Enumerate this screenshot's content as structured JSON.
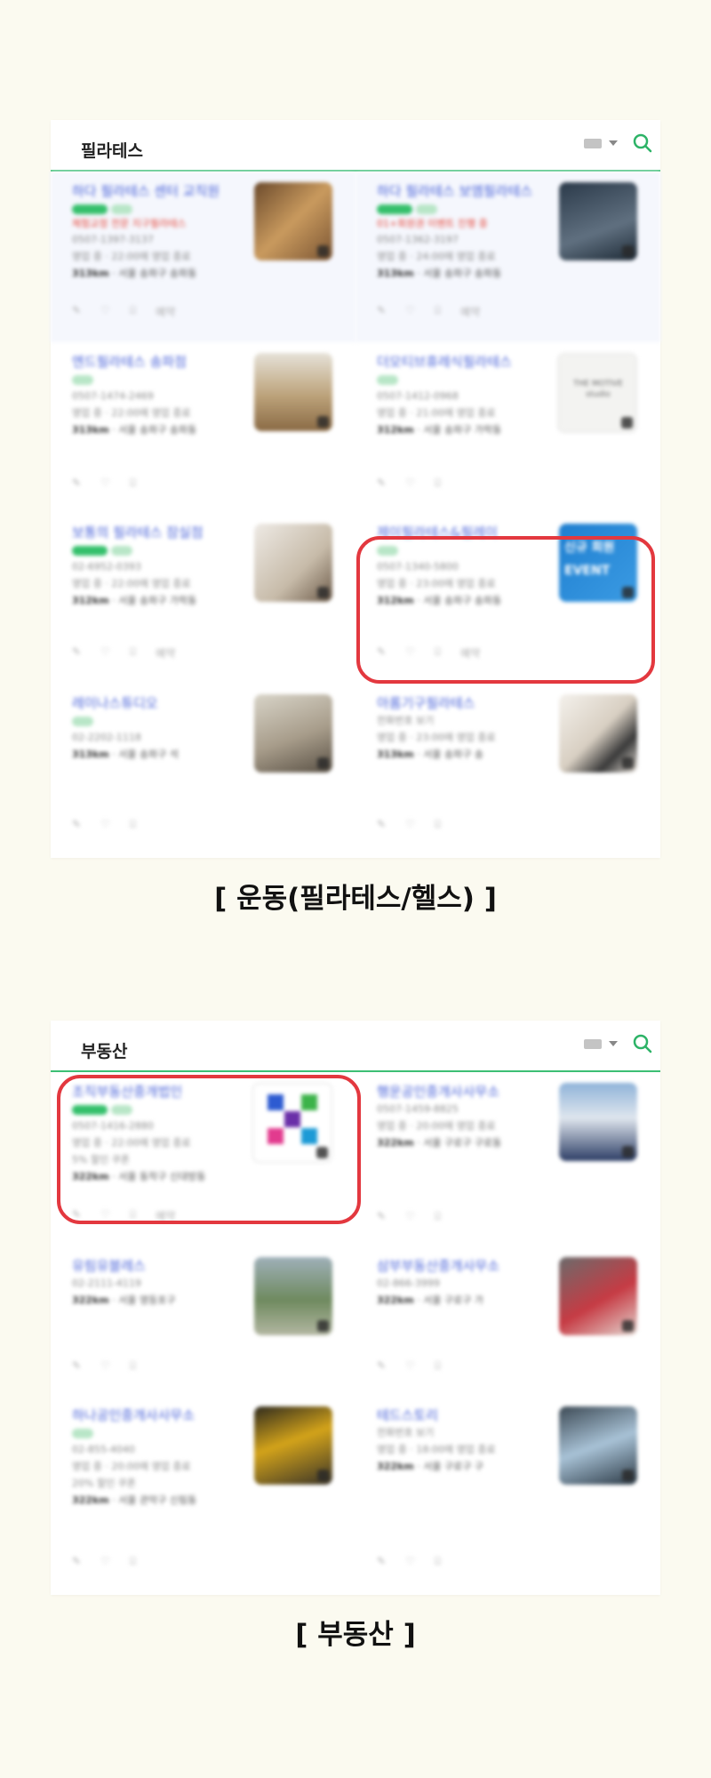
{
  "section1": {
    "title": "필라테스",
    "caption": "[ 운동(필라테스/헬스) ]",
    "cards": [
      {
        "name": "하다 필라테스 센터 교직원",
        "promo": "체험교정 전문 지구필라테스",
        "phone": "0507-1397-3137",
        "hours": "영업 중 · 22:00에 영업 종료",
        "dist": "313km",
        "addr": "· 서울 송파구 송파동",
        "actions": [
          "✎",
          "♡",
          "⌸",
          "예약"
        ]
      },
      {
        "name": "하다 필라테스 보엠필라테스",
        "promo": "01+회원권 이벤트 진행 중",
        "phone": "0507-1362-3197",
        "hours": "영업 중 · 24:00에 영업 종료",
        "dist": "313km",
        "addr": "· 서울 송파구 송파동",
        "actions": [
          "✎",
          "♡",
          "⌸",
          "예약"
        ]
      },
      {
        "name": "엔드필라테스 송파점",
        "promo": "",
        "phone": "0507-1474-2469",
        "hours": "영업 중 · 22:00에 영업 종료",
        "dist": "313km",
        "addr": "· 서울 송파구 송파동",
        "actions": [
          "✎",
          "♡",
          "⌸"
        ]
      },
      {
        "name": "더모티브휴레식필라테스",
        "promo": "",
        "phone": "0507-1412-0968",
        "hours": "영업 중 · 21:00에 영업 종료",
        "dist": "312km",
        "addr": "· 서울 송파구 가락동",
        "actions": [
          "✎",
          "♡",
          "⌸"
        ]
      },
      {
        "name": "보통의 필라테스 잠실점",
        "promo": "",
        "phone": "02-6952-0393",
        "hours": "영업 중 · 22:00에 영업 종료",
        "dist": "312km",
        "addr": "· 서울 송파구 가락동",
        "actions": [
          "✎",
          "♡",
          "⌸",
          "예약"
        ]
      },
      {
        "name": "제이필라테스&필레이",
        "promo": "",
        "phone": "0507-1340-5800",
        "hours": "영업 중 · 23:00에 영업 종료",
        "dist": "312km",
        "addr": "· 서울 송파구 송파동",
        "actions": [
          "✎",
          "♡",
          "⌸",
          "예약"
        ]
      },
      {
        "name": "레이나스튜디오",
        "promo": "",
        "phone": "02-2202-1118",
        "hours": "",
        "dist": "313km",
        "addr": "· 서울 송파구 석",
        "actions": [
          "✎",
          "♡",
          "⌸"
        ]
      },
      {
        "name": "아롬기구필라테스",
        "promo": "",
        "phone": "전화번호 보기",
        "hours": "영업 중 · 23:00에 영업 종료",
        "dist": "313km",
        "addr": "· 서울 송파구 송",
        "actions": [
          "✎",
          "♡",
          "⌸"
        ]
      }
    ],
    "event_lines": [
      "신규 회원",
      "EVENT"
    ],
    "motive_text": "THE MOTIVE studio"
  },
  "section2": {
    "title": "부동산",
    "caption": "[ 부동산 ]",
    "cards": [
      {
        "name": "조직부동산중개법인",
        "promo": "",
        "phone": "0507-1416-2880",
        "hours": "영업 중 · 22:00에 영업 종료",
        "extra": "5% 할인 쿠폰",
        "dist": "322km",
        "addr": "· 서울 동작구 신대방동",
        "actions": [
          "✎",
          "♡",
          "⌸",
          "예약"
        ]
      },
      {
        "name": "행운공인중개사사무소",
        "promo": "",
        "phone": "0507-1459-8825",
        "hours": "영업 중 · 20:00에 영업 종료",
        "extra": "",
        "dist": "322km",
        "addr": "· 서울 구로구 구로동",
        "actions": [
          "✎",
          "♡",
          "⌸"
        ]
      },
      {
        "name": "유림유블레스",
        "promo": "",
        "phone": "02-2111-4119",
        "hours": "",
        "extra": "",
        "dist": "322km",
        "addr": "· 서울 영등포구",
        "actions": [
          "✎",
          "♡",
          "⌸"
        ]
      },
      {
        "name": "삼부부동산중개사무소",
        "promo": "",
        "phone": "02-866-3999",
        "hours": "",
        "extra": "",
        "dist": "322km",
        "addr": "· 서울 구로구 가",
        "actions": [
          "✎",
          "♡",
          "⌸"
        ]
      },
      {
        "name": "하나공인중개사사무소",
        "promo": "",
        "phone": "02-855-4040",
        "hours": "영업 중 · 20:00에 영업 종료",
        "extra": "20% 할인 쿠폰",
        "dist": "322km",
        "addr": "· 서울 관악구 신림동",
        "actions": [
          "✎",
          "♡",
          "⌸"
        ]
      },
      {
        "name": "테드스토리",
        "promo": "",
        "phone": "전화번호 보기",
        "hours": "영업 중 · 18:00에 영업 종료",
        "extra": "",
        "dist": "322km",
        "addr": "· 서울 구로구 구",
        "actions": [
          "✎",
          "♡",
          "⌸"
        ]
      }
    ]
  },
  "colors": {
    "accent_green": "#3cbf74",
    "highlight_red": "#e3383f",
    "link_blue": "#4a63d9",
    "background": "#fbfaf0"
  },
  "icons": {
    "keyboard": "keyboard-icon",
    "dropdown": "caret-down-icon",
    "search": "search-icon"
  }
}
